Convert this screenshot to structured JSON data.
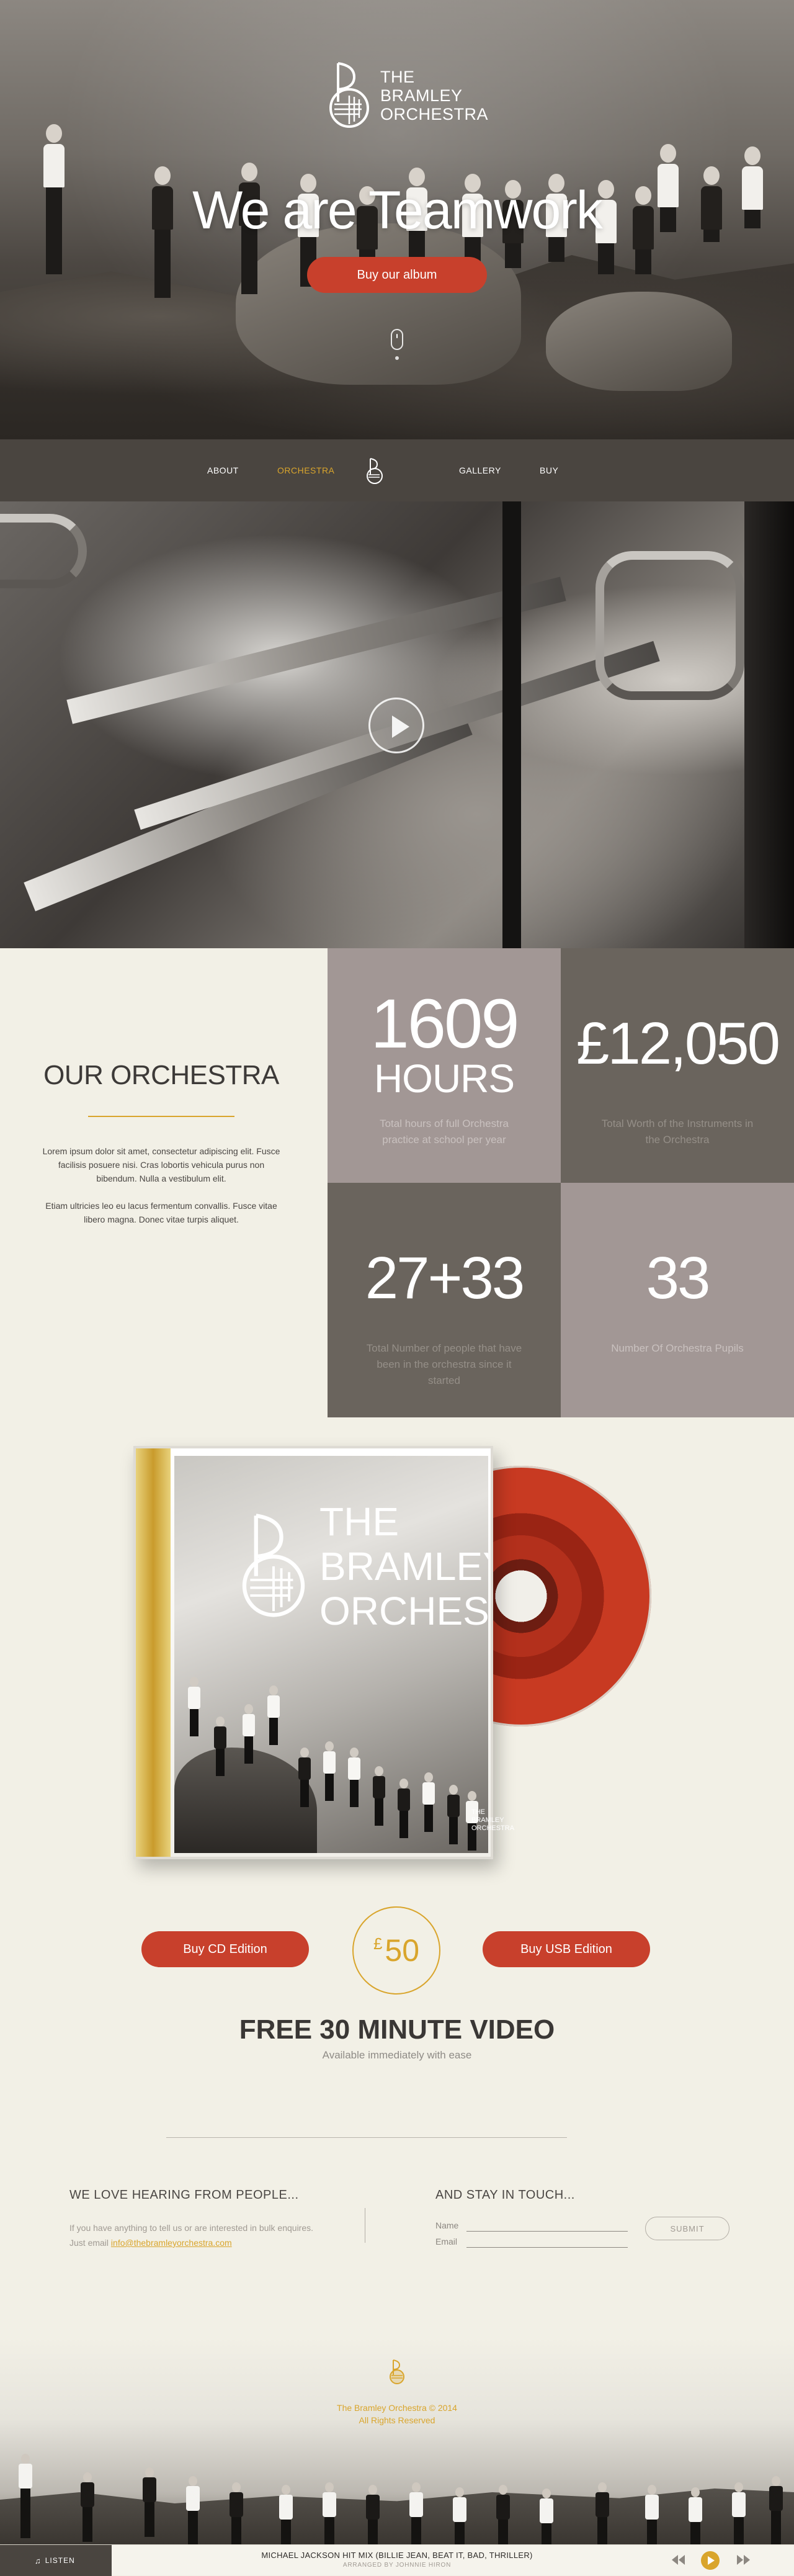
{
  "brand": {
    "name_lines": [
      "THE",
      "BRAMLEY",
      "ORCHESTRA"
    ]
  },
  "hero": {
    "title": "We are Teamwork",
    "cta_label": "Buy our album"
  },
  "nav": {
    "items": [
      {
        "label": "ABOUT"
      },
      {
        "label": "ORCHESTRA",
        "active": true
      },
      {
        "label": "GALLERY"
      },
      {
        "label": "BUY"
      }
    ]
  },
  "orchestra": {
    "title": "OUR ORCHESTRA",
    "paragraphs": [
      "Lorem ipsum dolor sit amet, consectetur adipiscing elit. Fusce facilisis posuere nisi. Cras lobortis vehicula purus non bibendum. Nulla a vestibulum elit.",
      "Etiam ultricies leo eu lacus fermentum convallis. Fusce vitae libero magna. Donec vitae turpis aliquet."
    ],
    "stats": [
      {
        "value": "1609",
        "unit": "HOURS",
        "label": "Total hours of full Orchestra practice at school per year"
      },
      {
        "value": "£12,050",
        "unit": "",
        "label": "Total Worth of the Instruments in the Orchestra"
      },
      {
        "value": "27+33",
        "unit": "",
        "label": "Total Number of people that have been in the orchestra since it started"
      },
      {
        "value": "33",
        "unit": "",
        "label": "Number Of Orchestra Pupils"
      }
    ]
  },
  "album": {
    "cover_small_text": [
      "THE",
      "BRAMLEY",
      "ORCHESTRA"
    ],
    "buy_cd_label": "Buy CD Edition",
    "buy_usb_label": "Buy USB Edition",
    "price_currency": "£",
    "price_value": "50",
    "free_title": "FREE 30 MINUTE VIDEO",
    "free_subtitle": "Available immediately with ease"
  },
  "contact": {
    "left_heading": "WE LOVE HEARING FROM PEOPLE...",
    "left_text": "If you have anything to tell us or are interested in bulk enquires. Just email",
    "email": "info@thebramleyorchestra.com",
    "right_heading": "AND STAY IN TOUCH...",
    "name_label": "Name",
    "email_label": "Email",
    "submit_label": "SUBMIT"
  },
  "footer": {
    "copyright": "The Bramley Orchestra © 2014",
    "rights": "All Rights Reserved"
  },
  "player": {
    "listen_label": "LISTEN",
    "track_title": "MICHAEL JACKSON HIT MIX (BILLIE JEAN, BEAT IT, BAD, THRILLER)",
    "track_subtitle": "ARRANGED BY JOHNNIE HIRON"
  },
  "colors": {
    "accent_gold": "#d9a52c",
    "button_red": "#c8402c",
    "nav_bg": "#4a4540",
    "stat_light": "#a29795",
    "stat_dark": "#6a645d",
    "page_bg": "#f2f0e6"
  }
}
